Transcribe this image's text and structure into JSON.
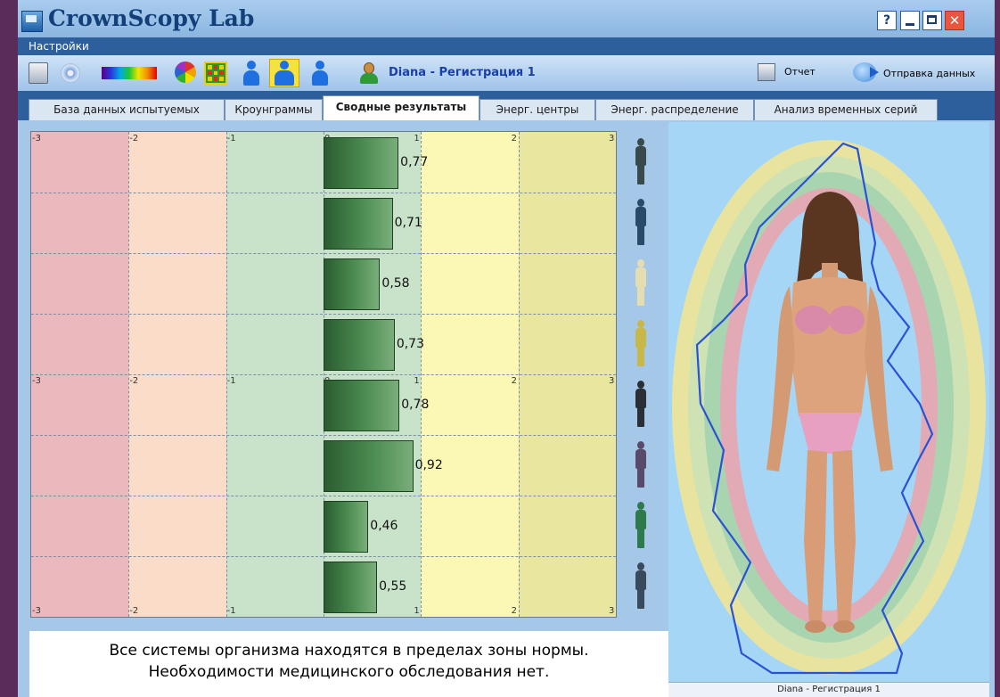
{
  "window": {
    "title": "CrownScopy Lab",
    "help_label": "?",
    "close_label": "✕"
  },
  "menu": {
    "settings": "Настройки"
  },
  "toolbar": {
    "icons": [
      "printer-icon",
      "disc-icon",
      "spectrum-icon",
      "color-wheel-icon",
      "grid-icon",
      "person-icon",
      "person-group-icon",
      "person-icon",
      "user-icon"
    ],
    "user_label": "Diana  - Регистрация 1",
    "report_label": "Отчет",
    "send_label": "Отправка данных"
  },
  "tabs": [
    {
      "label": "База данных испытуемых",
      "active": false
    },
    {
      "label": "Кроунграммы",
      "active": false
    },
    {
      "label": "Сводные результаты",
      "active": true
    },
    {
      "label": "Энерг. центры",
      "active": false
    },
    {
      "label": "Энерг. распределение",
      "active": false
    },
    {
      "label": "Анализ временных серий",
      "active": false
    }
  ],
  "chart_data": {
    "type": "bar",
    "orientation": "horizontal",
    "xlim": [
      -3,
      3
    ],
    "xticks": [
      "-3",
      "-2",
      "-1",
      "0",
      "1",
      "2",
      "3"
    ],
    "values": [
      0.77,
      0.71,
      0.58,
      0.73,
      0.78,
      0.92,
      0.46,
      0.55
    ],
    "value_labels": [
      "0,77",
      "0,71",
      "0,58",
      "0,73",
      "0,78",
      "0,92",
      "0,46",
      "0,55"
    ],
    "zones": [
      {
        "range": [
          -3,
          -2
        ],
        "color": "#ebb9bd"
      },
      {
        "range": [
          -2,
          -1
        ],
        "color": "#fbdcc8"
      },
      {
        "range": [
          -1,
          0
        ],
        "color": "#c8e3c9"
      },
      {
        "range": [
          0,
          1
        ],
        "color": "#c8e3c9"
      },
      {
        "range": [
          1,
          2
        ],
        "color": "#fbf7b4"
      },
      {
        "range": [
          2,
          3
        ],
        "color": "#e9e6a0"
      }
    ],
    "bar_color": "#3f7a46",
    "grid": true
  },
  "system_icons": [
    {
      "name": "body-system-icon",
      "color": "#3a4a4a"
    },
    {
      "name": "nervous-system-icon",
      "color": "#2a4a6a"
    },
    {
      "name": "skeletal-system-icon",
      "color": "#e4ddb0"
    },
    {
      "name": "endocrine-system-icon",
      "color": "#c8b848"
    },
    {
      "name": "muscular-system-icon",
      "color": "#2a2f35"
    },
    {
      "name": "circulatory-system-icon",
      "color": "#5a4a6a"
    },
    {
      "name": "lymphatic-system-icon",
      "color": "#2f7a4a"
    },
    {
      "name": "cardiovascular-system-icon",
      "color": "#3a4a5a"
    }
  ],
  "message": {
    "line1": "Все системы организма находятся в пределах зоны нормы.",
    "line2": "Необходимости медицинского обследования нет."
  },
  "aura": {
    "footer": "Diana  - Регистрация 1"
  }
}
